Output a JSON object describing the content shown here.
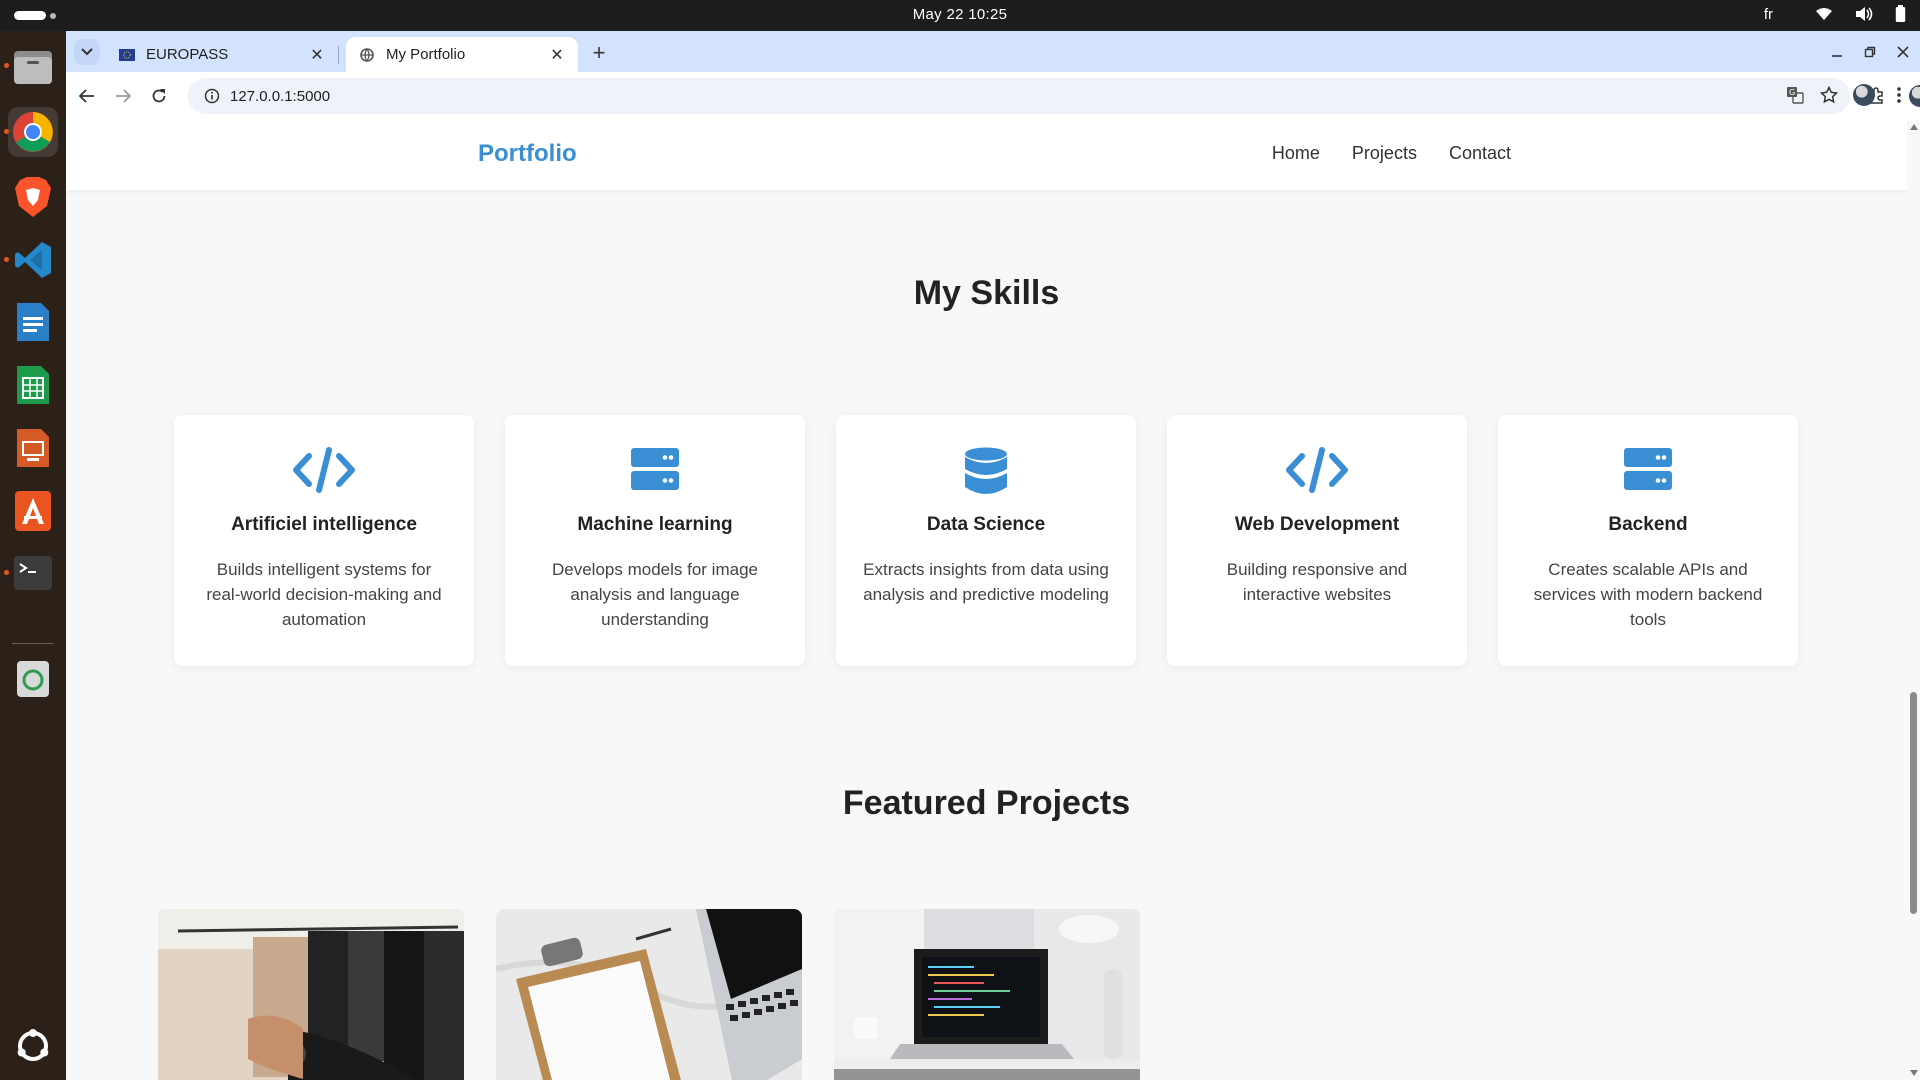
{
  "system": {
    "clock": "May 22  10:25",
    "language": "fr"
  },
  "browser": {
    "tabs": [
      {
        "title": "EUROPASS",
        "active": false
      },
      {
        "title": "My Portfolio",
        "active": true
      }
    ],
    "url": "127.0.0.1:5000"
  },
  "site": {
    "logo": "Portfolio",
    "nav": [
      "Home",
      "Projects",
      "Contact"
    ],
    "skills_title": "My Skills",
    "skills": [
      {
        "icon": "code-icon",
        "title": "Artificiel intelligence",
        "text": "Builds intelligent systems for real-world decision-making and automation"
      },
      {
        "icon": "server-icon",
        "title": "Machine learning",
        "text": "Develops models for image analysis and language understanding"
      },
      {
        "icon": "database-icon",
        "title": "Data Science",
        "text": "Extracts insights from data using analysis and predictive modeling"
      },
      {
        "icon": "code-icon",
        "title": "Web Development",
        "text": "Building responsive and interactive websites"
      },
      {
        "icon": "server-icon",
        "title": "Backend",
        "text": "Creates scalable APIs and services with modern backend tools"
      }
    ],
    "projects_title": "Featured Projects",
    "projects": [
      {
        "image": "clothing-rack-photo"
      },
      {
        "image": "clipboard-laptop-photo"
      },
      {
        "image": "laptop-desk-photo"
      }
    ]
  },
  "colors": {
    "accent": "#3a8fd4",
    "dock": "#2b2119",
    "tabstrip": "#d3e3fd"
  }
}
